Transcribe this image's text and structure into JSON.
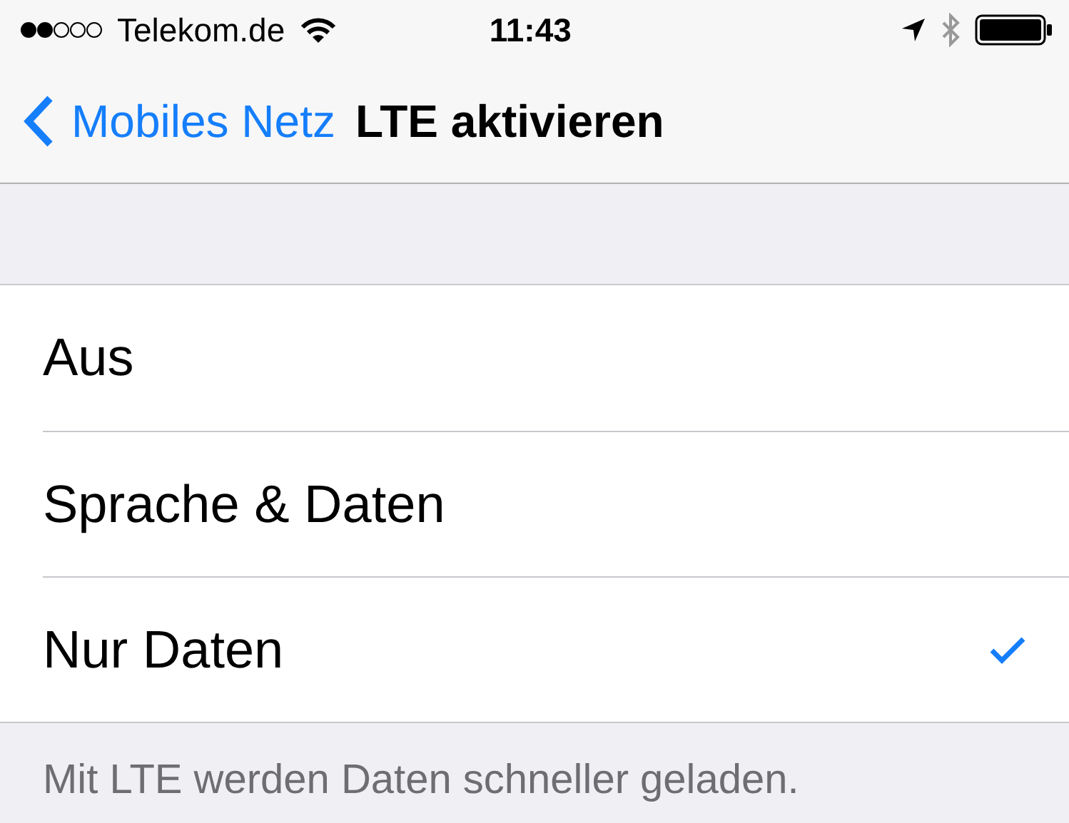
{
  "status_bar": {
    "carrier": "Telekom.de",
    "time": "11:43"
  },
  "nav": {
    "back": "Mobiles Netz",
    "title": "LTE aktivieren"
  },
  "options": [
    {
      "label": "Aus",
      "selected": false
    },
    {
      "label": "Sprache & Daten",
      "selected": false
    },
    {
      "label": "Nur Daten",
      "selected": true
    }
  ],
  "footer": "Mit LTE werden Daten schneller geladen."
}
